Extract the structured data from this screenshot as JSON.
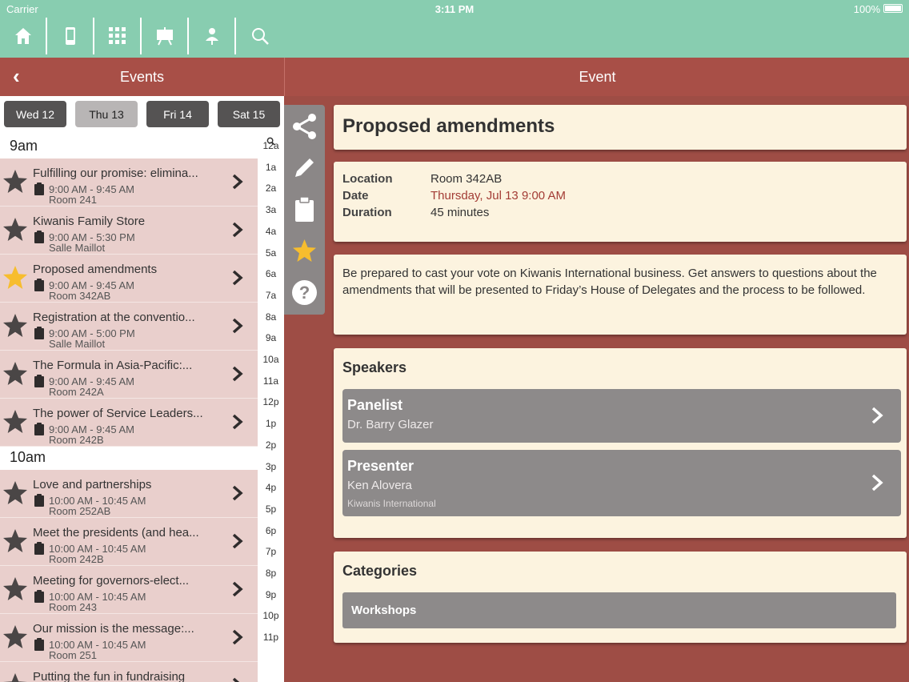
{
  "status": {
    "carrier": "Carrier",
    "time": "3:11 PM",
    "battery": "100%"
  },
  "toolbar": [
    {
      "name": "home-icon"
    },
    {
      "name": "phone-icon"
    },
    {
      "name": "grid-icon"
    },
    {
      "name": "easel-icon"
    },
    {
      "name": "person-icon"
    },
    {
      "name": "search-icon"
    }
  ],
  "left": {
    "header_title": "Events",
    "days": [
      "Wed 12",
      "Thu 13",
      "Fri 14",
      "Sat 15"
    ],
    "active_day": 1,
    "sections": [
      {
        "label": "9am",
        "events": [
          {
            "title": "Fulfilling our promise: elimina...",
            "time": "9:00 AM - 9:45 AM",
            "room": "Room 241",
            "starred": false
          },
          {
            "title": "Kiwanis Family Store",
            "time": "9:00 AM - 5:30 PM",
            "room": "Salle Maillot",
            "starred": false
          },
          {
            "title": "Proposed amendments",
            "time": "9:00 AM - 9:45 AM",
            "room": "Room 342AB",
            "starred": true
          },
          {
            "title": "Registration at the conventio...",
            "time": "9:00 AM - 5:00 PM",
            "room": "Salle Maillot",
            "starred": false
          },
          {
            "title": "The Formula in Asia-Pacific:...",
            "time": "9:00 AM - 9:45 AM",
            "room": "Room 242A",
            "starred": false
          },
          {
            "title": "The power of Service Leaders...",
            "time": "9:00 AM - 9:45 AM",
            "room": "Room 242B",
            "starred": false
          }
        ]
      },
      {
        "label": "10am",
        "events": [
          {
            "title": "Love and partnerships",
            "time": "10:00 AM - 10:45 AM",
            "room": "Room 252AB",
            "starred": false
          },
          {
            "title": "Meet the presidents (and hea...",
            "time": "10:00 AM - 10:45 AM",
            "room": "Room 242B",
            "starred": false
          },
          {
            "title": "Meeting for governors-elect...",
            "time": "10:00 AM - 10:45 AM",
            "room": "Room 243",
            "starred": false
          },
          {
            "title": "Our mission is the message:...",
            "time": "10:00 AM - 10:45 AM",
            "room": "Room 251",
            "starred": false
          },
          {
            "title": "Putting the fun in fundraising",
            "time": "",
            "room": "",
            "starred": false
          }
        ]
      }
    ],
    "index": [
      "12a",
      "1a",
      "2a",
      "3a",
      "4a",
      "5a",
      "6a",
      "7a",
      "8a",
      "9a",
      "10a",
      "11a",
      "12p",
      "1p",
      "2p",
      "3p",
      "4p",
      "5p",
      "6p",
      "7p",
      "8p",
      "9p",
      "10p",
      "11p"
    ]
  },
  "actions": [
    {
      "name": "share-icon"
    },
    {
      "name": "pencil-icon"
    },
    {
      "name": "clipboard-icon"
    },
    {
      "name": "star-icon"
    },
    {
      "name": "help-icon"
    }
  ],
  "event": {
    "header_title": "Event",
    "title": "Proposed amendments",
    "location_label": "Location",
    "location": "Room 342AB",
    "date_label": "Date",
    "date": "Thursday, Jul 13 9:00 AM",
    "duration_label": "Duration",
    "duration": "45 minutes",
    "description": "Be prepared to cast your vote on Kiwanis International business. Get answers to questions about the amendments that will be presented to Friday’s House of Delegates and the process to be followed.",
    "speakers_heading": "Speakers",
    "speakers": [
      {
        "role": "Panelist",
        "name": "Dr. Barry Glazer",
        "org": ""
      },
      {
        "role": "Presenter",
        "name": "Ken Alovera",
        "org": "Kiwanis International"
      }
    ],
    "categories_heading": "Categories",
    "categories": [
      "Workshops"
    ]
  },
  "colors": {
    "toolbar": "#88cdb0",
    "header": "#a84f47",
    "card": "#fcf3df",
    "star_active": "#f7bd2e",
    "date_red": "#a33c35"
  }
}
